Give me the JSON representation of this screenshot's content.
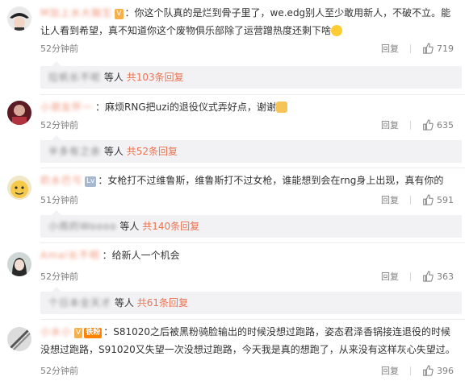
{
  "comments": [
    {
      "name": "M加上水大脑生",
      "badge": "V",
      "text": "你这个队真的是烂到骨子里了，we.edg别人至少敢用新人，不破不立。能让人看到希望，真不知道你这个废物俱乐部除了运营蹭热度还剩下啥",
      "time": "52分钟前",
      "reply_label": "回复",
      "likes": "719",
      "sub": {
        "name": "拉帆长不呢",
        "tail": "等人",
        "more": "共103条回复"
      }
    },
    {
      "name": "小朋友怀一",
      "badge": "",
      "text": "麻烦RNG把uzi的退役仪式弄好点，谢谢",
      "time": "52分钟前",
      "reply_label": "回复",
      "likes": "635",
      "sub": {
        "name": "半多有之余",
        "tail": "等人",
        "more": "共52条回复"
      }
    },
    {
      "name": "奶水巴弓",
      "badge": "Lv",
      "text": "女枪打不过维鲁斯，维鲁斯打不过女枪，谁能想到会在rng身上出现，真有你的",
      "time": "51分钟前",
      "reply_label": "回复",
      "likes": "591",
      "sub": {
        "name": "小雨的Woooo",
        "tail": "等人",
        "more": "共140条回复"
      }
    },
    {
      "name": "Amal长不明",
      "badge": "",
      "text": "给新人一个机会",
      "time": "52分钟前",
      "reply_label": "回复",
      "likes": "363",
      "sub": {
        "name": "个日本全天才",
        "tail": "等人",
        "more": "共61条回复"
      }
    },
    {
      "name": "小水小",
      "badge": "铁粉",
      "text": "S81020之后被黑粉骑脸输出的时候没想过跑路，姿态君泽香锅接连退役的时候没想过跑路，S91020又失望一次没想过跑路，今天我是真的想跑了，从来没有这样灰心失望过。",
      "time": "52分钟前",
      "reply_label": "回复",
      "likes": "396"
    }
  ],
  "colors": {
    "accent": "#eb7350",
    "meta": "#808080",
    "reply_bg": "#f2f2f5"
  }
}
